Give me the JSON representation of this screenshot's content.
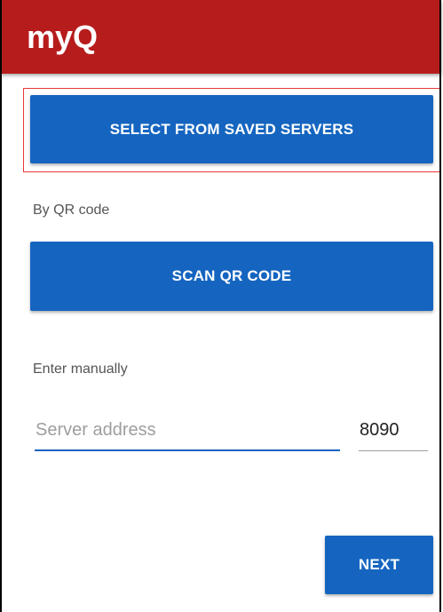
{
  "app": {
    "logo_text": "myQ",
    "brand_color": "#b71c1c",
    "accent_color": "#1565c0"
  },
  "saved_servers": {
    "button_label": "SELECT FROM SAVED SERVERS"
  },
  "qr_section": {
    "label": "By QR code",
    "button_label": "SCAN QR CODE"
  },
  "manual_section": {
    "label": "Enter manually",
    "server_address_placeholder": "Server address",
    "server_address_value": "",
    "port_value": "8090"
  },
  "footer": {
    "next_label": "NEXT"
  }
}
